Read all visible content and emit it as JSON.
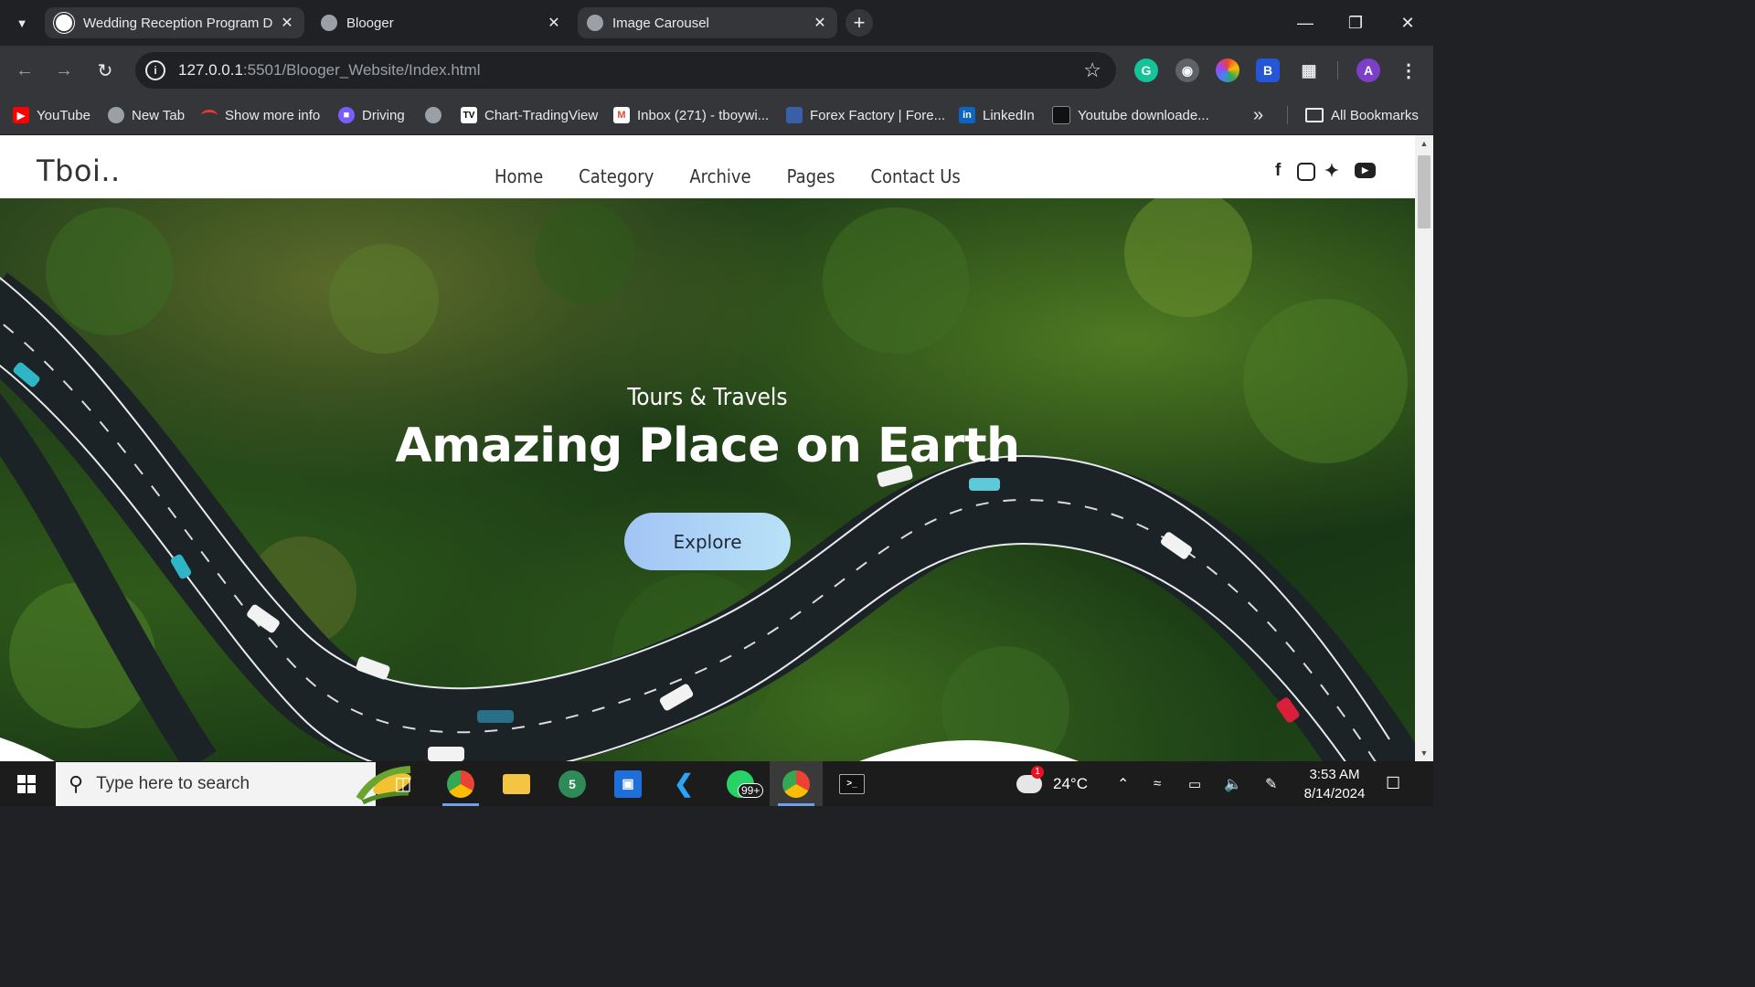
{
  "browser": {
    "tabs": [
      {
        "title": "Wedding Reception Program D",
        "active": true,
        "icon": "chatgpt-icon"
      },
      {
        "title": "Blooger",
        "active": false,
        "icon": "globe-icon"
      },
      {
        "title": "Image Carousel",
        "active": true,
        "icon": "globe-icon"
      }
    ],
    "new_tab_symbol": "+",
    "address": {
      "host": "127.0.0.1",
      "path": ":5501/Blooger_Website/Index.html"
    },
    "profile_initial": "A",
    "bookmarks": [
      {
        "label": "YouTube",
        "icon": "youtube-icon"
      },
      {
        "label": "New Tab",
        "icon": "globe-icon"
      },
      {
        "label": "Show more info",
        "icon": "arc-icon"
      },
      {
        "label": "Driving",
        "icon": "twitch-icon"
      },
      {
        "label": "",
        "icon": "globe-icon"
      },
      {
        "label": "Chart-TradingView",
        "icon": "tradingview-icon"
      },
      {
        "label": "Inbox (271) - tboywi...",
        "icon": "gmail-icon"
      },
      {
        "label": "Forex Factory | Fore...",
        "icon": "forexfactory-icon"
      },
      {
        "label": "LinkedIn",
        "icon": "linkedin-icon"
      },
      {
        "label": "Youtube downloade...",
        "icon": "downloader-icon"
      }
    ],
    "overflow_symbol": "»",
    "all_bookmarks": "All Bookmarks"
  },
  "site": {
    "logo": "Tboi..",
    "nav": [
      "Home",
      "Category",
      "Archive",
      "Pages",
      "Contact Us"
    ],
    "social_icons": [
      "facebook-icon",
      "instagram-icon",
      "twitter-icon",
      "youtube-icon"
    ],
    "hero": {
      "subtitle": "Tours & Travels",
      "title": "Amazing Place on Earth",
      "button": "Explore"
    }
  },
  "taskbar": {
    "search_placeholder": "Type here to search",
    "whatsapp_badge": "99+",
    "weather_temp": "24°C",
    "weather_alert": "1",
    "time": "3:53 AM",
    "date": "8/14/2024"
  },
  "colors": {
    "browser_bg": "#202124",
    "toolbar_bg": "#35363a",
    "explore_button": "#a2c4f5",
    "taskbar_bg": "#1c1c1c"
  }
}
